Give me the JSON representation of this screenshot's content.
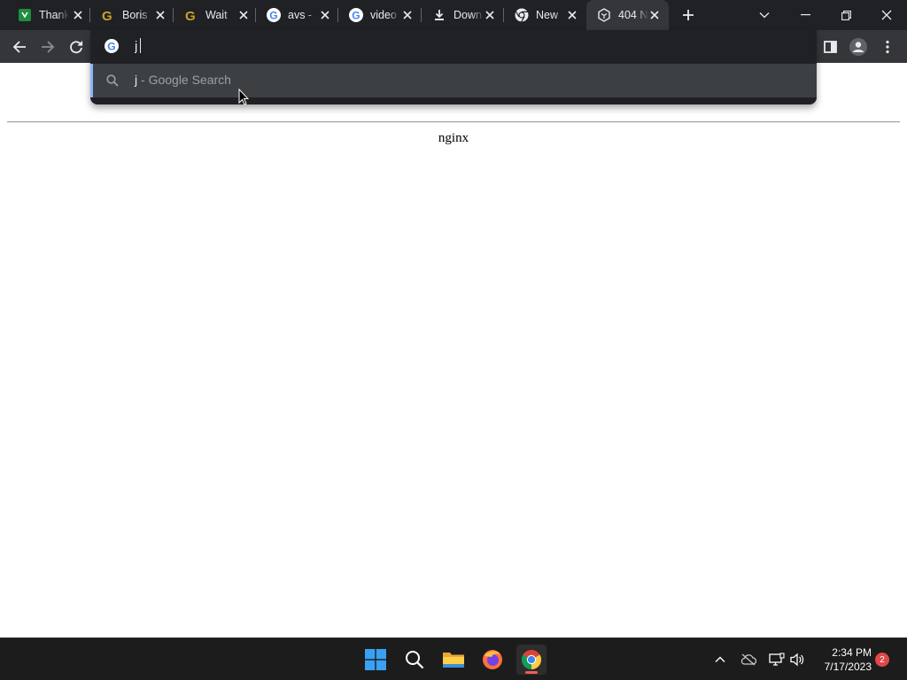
{
  "browser": {
    "tabs": [
      {
        "title": "Thank",
        "icon": "green-sheet-icon"
      },
      {
        "title": "Boris",
        "icon": "grammarly-icon"
      },
      {
        "title": "Wait",
        "icon": "grammarly-icon"
      },
      {
        "title": "avs -",
        "icon": "google-icon"
      },
      {
        "title": "video",
        "icon": "google-icon"
      },
      {
        "title": "Down",
        "icon": "download-icon"
      },
      {
        "title": "New",
        "icon": "chrome-icon"
      },
      {
        "title": "404 N",
        "icon": "page-icon",
        "active": true
      }
    ],
    "omnibox": {
      "value": "j",
      "suggestion_query": "j",
      "suggestion_suffix": " - Google Search"
    }
  },
  "page": {
    "server_name": "nginx"
  },
  "taskbar": {
    "time": "2:34 PM",
    "date": "7/17/2023",
    "notification_count": "2"
  },
  "colors": {
    "accent_blue": "#8ab4f8",
    "badge_red": "#e0484a",
    "tabstrip": "#202124",
    "toolbar": "#35363a"
  }
}
